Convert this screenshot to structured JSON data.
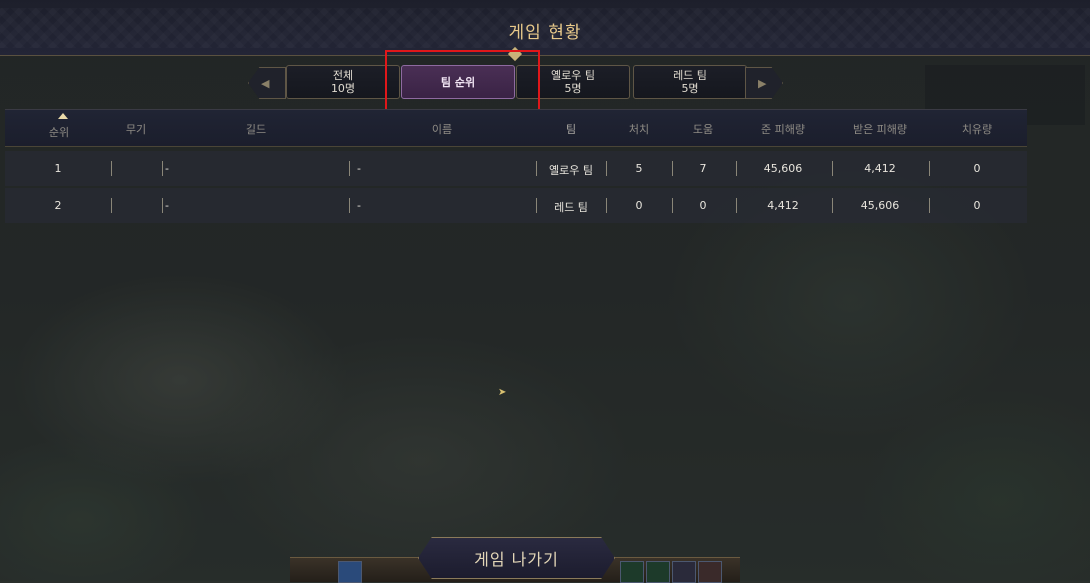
{
  "window": {
    "title": "게임 현황"
  },
  "tabs": [
    {
      "label": "전체",
      "count": "10명"
    },
    {
      "label": "팀 순위",
      "count": ""
    },
    {
      "label": "옐로우 팀",
      "count": "5명"
    },
    {
      "label": "레드 팀",
      "count": "5명"
    }
  ],
  "active_tab": "팀 순위",
  "table": {
    "headers": [
      "순위",
      "무기",
      "길드",
      "이름",
      "팀",
      "처치",
      "도움",
      "준 피해량",
      "받은 피해량",
      "치유량"
    ],
    "sorted_column": "순위",
    "rows": [
      {
        "rank": "1",
        "weapon": "-",
        "guild": "-",
        "name": "",
        "team": "옐로우 팀",
        "kills": "5",
        "assists": "7",
        "damage_dealt": "45,606",
        "damage_taken": "4,412",
        "healing": "0"
      },
      {
        "rank": "2",
        "weapon": "-",
        "guild": "-",
        "name": "",
        "team": "레드 팀",
        "kills": "0",
        "assists": "0",
        "damage_dealt": "4,412",
        "damage_taken": "45,606",
        "healing": "0"
      }
    ]
  },
  "footer": {
    "exit_label": "게임 나가기"
  },
  "colors": {
    "title_gold": "#e8c98a",
    "active_tab": "#4a2f55",
    "highlight_red": "#e0171a"
  }
}
